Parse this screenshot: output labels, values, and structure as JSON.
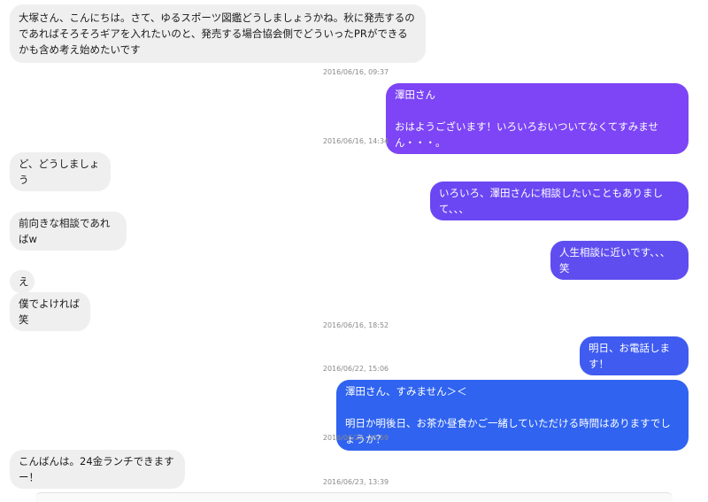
{
  "messages": [
    {
      "text": "大塚さん、こんにちは。さて、ゆるスポーツ図鑑どうしましょうかね。秋に発売するのであればそろそろギアを入れたいのと、発売する場合協会側でどういったPRができるかも含め考え始めたいです"
    },
    {
      "text": "澤田さん\n\nおはようございます！いろいろおいついてなくてすみません・・・。"
    },
    {
      "text": "ど、どうしましょう"
    },
    {
      "text": "いろいろ、澤田さんに相談したいこともありまして、、、"
    },
    {
      "text": "前向きな相談であればw"
    },
    {
      "text": "人生相談に近いです、、、笑"
    },
    {
      "text": "え"
    },
    {
      "text": "僕でよければ笑"
    },
    {
      "text": "明日、お電話します！"
    },
    {
      "text": "澤田さん、すみません＞＜\n\n明日か明後日、お茶か昼食かご一緒していただける時間はありますでしょうか？"
    },
    {
      "text": "こんばんは。24金ランチできますー！"
    }
  ],
  "timestamps": [
    "2016/06/16, 09:37",
    "2016/06/16, 14:34",
    "2016/06/16, 18:52",
    "2016/06/22, 15:06",
    "2016/06/22, 23:59",
    "2016/06/23, 13:39"
  ],
  "colors": {
    "incoming_bubble": "#efefef",
    "outgoing_purple": "#7d45f5",
    "outgoing_indigo": "#5f4df0",
    "outgoing_blue": "#2f63f0"
  }
}
